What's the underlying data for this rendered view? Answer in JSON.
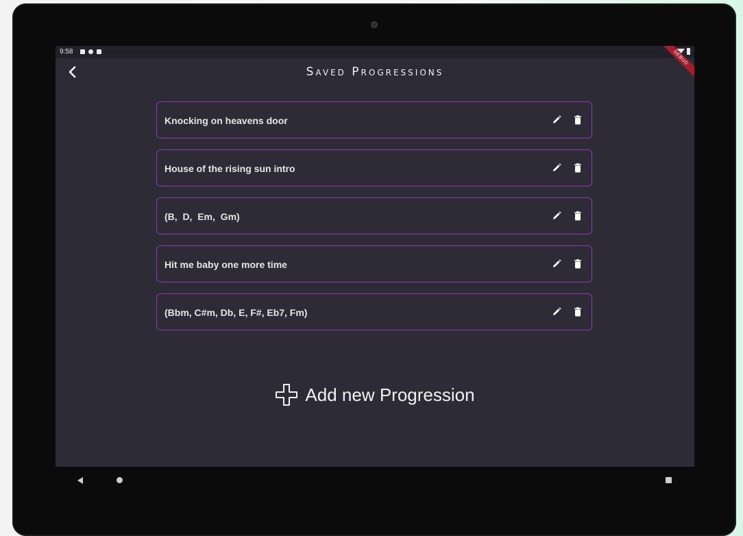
{
  "statusbar": {
    "time": "9:58",
    "debug_label": "DEBUG"
  },
  "appbar": {
    "back_icon": "chevron-left-icon",
    "title": "Saved Progressions"
  },
  "progressions": [
    {
      "label": "Knocking on heavens door"
    },
    {
      "label": "House of the rising sun intro"
    },
    {
      "label": "(B,  D,  Em,  Gm)"
    },
    {
      "label": "Hit me baby one more time"
    },
    {
      "label": "(Bbm, C#m, Db, E, F#, Eb7, Fm)"
    }
  ],
  "item_icons": {
    "edit": "pencil-icon",
    "delete": "trash-icon"
  },
  "add": {
    "icon": "plus-icon",
    "label": "Add new Progression"
  },
  "colors": {
    "background": "#2d2c36",
    "accent_border": "#8a3db0",
    "text": "#e6e6e6"
  }
}
